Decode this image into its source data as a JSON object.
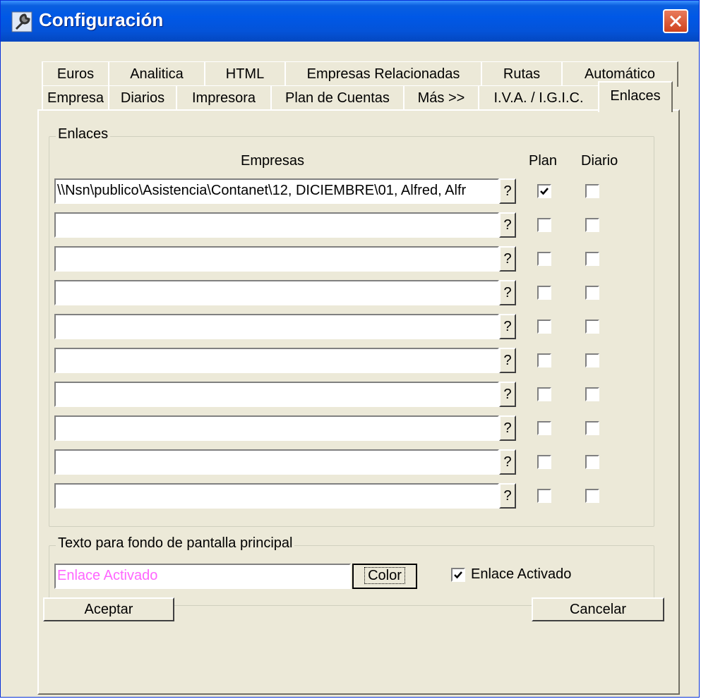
{
  "window": {
    "title": "Configuración",
    "icon": "wrench-icon",
    "close_icon": "close-icon",
    "accent_color": "#0058e6"
  },
  "tabs": {
    "back_row": [
      "Euros",
      "Analitica",
      "HTML",
      "Empresas Relacionadas",
      "Rutas",
      "Automático"
    ],
    "front_row": [
      "Empresa",
      "Diarios",
      "Impresora",
      "Plan de Cuentas",
      "Más >>",
      "I.V.A. / I.G.I.C.",
      "Enlaces"
    ],
    "active": "Enlaces"
  },
  "enlaces": {
    "group_label": "Enlaces",
    "col_empresas": "Empresas",
    "col_plan": "Plan",
    "col_diario": "Diario",
    "browse_label": "?",
    "rows": [
      {
        "path": "\\\\Nsn\\publico\\Asistencia\\Contanet\\12, DICIEMBRE\\01, Alfred, Alfr",
        "plan": true,
        "diario": false
      },
      {
        "path": "",
        "plan": false,
        "diario": false
      },
      {
        "path": "",
        "plan": false,
        "diario": false
      },
      {
        "path": "",
        "plan": false,
        "diario": false
      },
      {
        "path": "",
        "plan": false,
        "diario": false
      },
      {
        "path": "",
        "plan": false,
        "diario": false
      },
      {
        "path": "",
        "plan": false,
        "diario": false
      },
      {
        "path": "",
        "plan": false,
        "diario": false
      },
      {
        "path": "",
        "plan": false,
        "diario": false
      },
      {
        "path": "",
        "plan": false,
        "diario": false
      }
    ]
  },
  "background_text": {
    "group_label": "Texto para fondo de pantalla principal",
    "value": "Enlace Activado",
    "text_color": "#ff66ff",
    "color_button": "Color",
    "checkbox_label": "Enlace Activado",
    "checkbox_checked": true
  },
  "footer": {
    "accept_label": "Aceptar",
    "cancel_label": "Cancelar"
  }
}
